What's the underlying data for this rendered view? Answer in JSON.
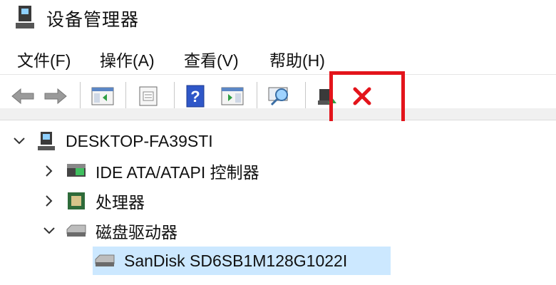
{
  "window": {
    "title": "设备管理器",
    "icon": "device-manager-icon"
  },
  "menu": [
    {
      "label": "文件(F)"
    },
    {
      "label": "操作(A)"
    },
    {
      "label": "查看(V)"
    },
    {
      "label": "帮助(H)"
    }
  ],
  "toolbar": {
    "buttons": [
      "back-arrow-icon",
      "forward-arrow-icon",
      "show-hide-tree-icon",
      "properties-icon",
      "help-icon",
      "action-pane-icon",
      "scan-hardware-icon",
      "update-driver-icon",
      "uninstall-device-icon"
    ],
    "highlight_color": "#e3141b"
  },
  "tree": {
    "root": {
      "label": "DESKTOP-FA39STI",
      "expanded": true
    },
    "items": [
      {
        "label": "IDE ATA/ATAPI 控制器",
        "expanded": false,
        "icon": "ide-controller-icon"
      },
      {
        "label": "处理器",
        "expanded": false,
        "icon": "processor-icon"
      },
      {
        "label": "磁盘驱动器",
        "expanded": true,
        "icon": "disk-drive-icon"
      }
    ],
    "child": {
      "label": "SanDisk SD6SB1M128G1022I",
      "selected": true,
      "icon": "disk-icon"
    }
  },
  "colors": {
    "selection": "#cce8ff",
    "uninstall_x": "#e3141b"
  }
}
